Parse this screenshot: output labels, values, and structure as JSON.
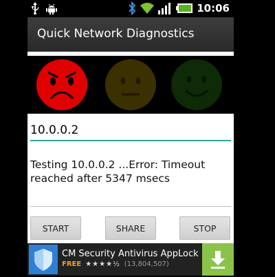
{
  "status_bar": {
    "time": "10:06",
    "left_icons": [
      "usb-icon",
      "android-debug-icon"
    ],
    "right_icons": [
      "bluetooth-icon",
      "wifi-icon",
      "signal-icon",
      "battery-icon"
    ]
  },
  "app": {
    "title": "Quick Network Diagnostics"
  },
  "faces": [
    {
      "name": "sad-face-icon",
      "state": "active",
      "color": "#e00000"
    },
    {
      "name": "neutral-face-icon",
      "state": "inactive",
      "color": "#3b3000"
    },
    {
      "name": "happy-face-icon",
      "state": "inactive",
      "color": "#0f2a06"
    }
  ],
  "input": {
    "value": "10.0.0.2"
  },
  "output": {
    "text": "Testing 10.0.0.2 ...Error: Timeout reached after 5347 msecs"
  },
  "buttons": {
    "start": "START",
    "share": "SHARE",
    "stop": "STOP"
  },
  "ad": {
    "title": "CM Security Antivirus AppLock",
    "price": "FREE",
    "stars": "★★★★½",
    "reviews": "(13,804,507)"
  },
  "colors": {
    "accent": "#2ea3a3",
    "ad_download": "#8bc34a",
    "ad_free": "#f0a020"
  }
}
